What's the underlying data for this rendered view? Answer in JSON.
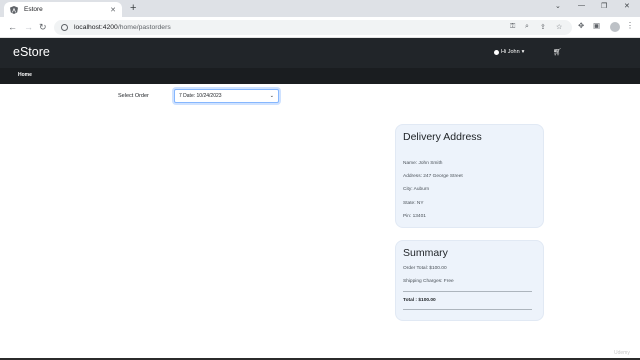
{
  "browser": {
    "tab_title": "Estore",
    "url_host": "localhost:4200",
    "url_path": "/home/pastorders"
  },
  "header": {
    "brand": "eStore",
    "user_greeting": "Hi John",
    "nav_home": "Home"
  },
  "order_selector": {
    "label": "Select Order",
    "value": "7 Date: 10/24/2023"
  },
  "delivery": {
    "title": "Delivery Address",
    "name": "Name: John Smith",
    "address": "Address: 247 George Street",
    "city": "City: Auburn",
    "state": "State: NY",
    "pin": "Pin: 13401"
  },
  "summary": {
    "title": "Summary",
    "order_total": "Order Total: $100.00",
    "shipping": "Shipping Charges: Free",
    "total": "Total : $100.00"
  },
  "watermark": "Udemy"
}
